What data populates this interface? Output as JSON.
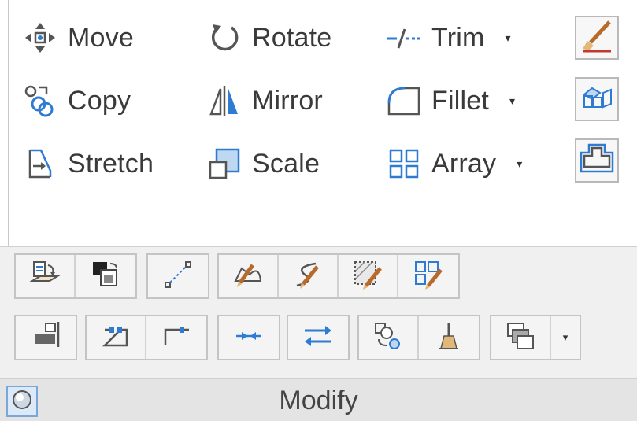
{
  "ribbon_panel": {
    "title": "Modify",
    "commands": [
      {
        "label": "Move",
        "icon": "move-icon"
      },
      {
        "label": "Rotate",
        "icon": "rotate-icon"
      },
      {
        "label": "Trim",
        "icon": "trim-icon",
        "has_dropdown": true
      },
      {
        "label": "Copy",
        "icon": "copy-icon"
      },
      {
        "label": "Mirror",
        "icon": "mirror-icon"
      },
      {
        "label": "Fillet",
        "icon": "fillet-icon",
        "has_dropdown": true
      },
      {
        "label": "Stretch",
        "icon": "stretch-icon"
      },
      {
        "label": "Scale",
        "icon": "scale-icon"
      },
      {
        "label": "Array",
        "icon": "array-icon",
        "has_dropdown": true
      }
    ],
    "side_tools": [
      "erase-icon",
      "explode-icon",
      "offset-icon"
    ],
    "expanded_tools_row1": [
      "change-space-icon",
      "draworder-icon",
      "lengthen-icon",
      "edit-polyline-icon",
      "edit-spline-icon",
      "edit-hatch-icon",
      "edit-array-icon"
    ],
    "expanded_tools_row2": [
      "align-icon",
      "break-at-point-icon",
      "break-icon",
      "join-icon",
      "reverse-icon",
      "set-to-bylayer-icon",
      "edit-text-icon",
      "draw-order-icon"
    ],
    "dropdown_caret": "▾",
    "colors": {
      "accent_blue": "#2e7bd1",
      "icon_gray": "#555555",
      "tan": "#e2b87a"
    }
  }
}
